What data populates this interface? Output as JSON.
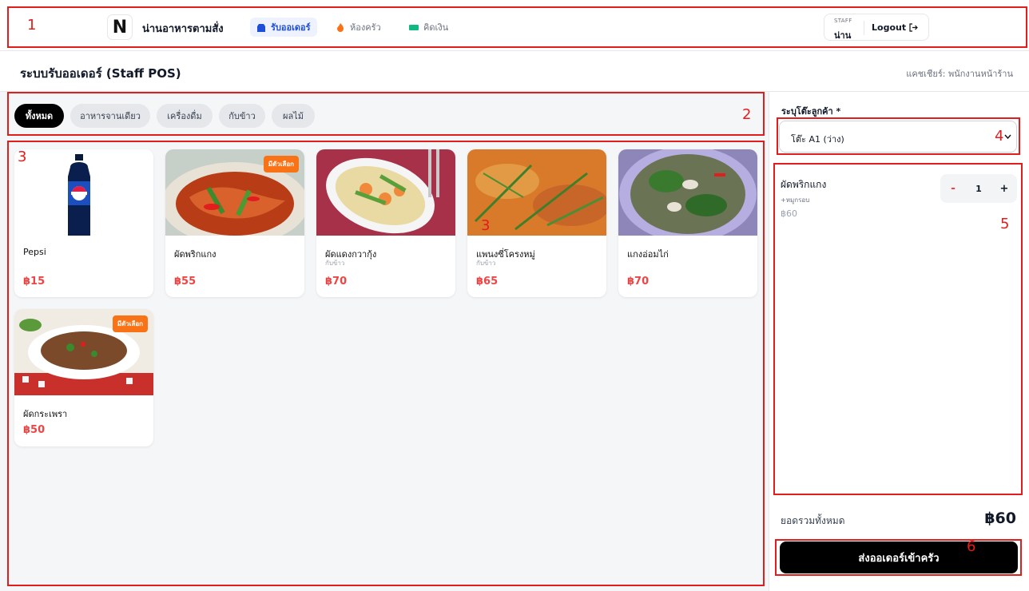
{
  "header": {
    "brand": "น่านอาหารตามสั่ง",
    "logo_letter": "N",
    "nav": [
      {
        "label": "รับออเดอร์",
        "icon": "store-icon",
        "active": true
      },
      {
        "label": "ห้องครัว",
        "icon": "fire-icon",
        "active": false
      },
      {
        "label": "คิดเงิน",
        "icon": "cash-icon",
        "active": false
      }
    ],
    "staff_label": "STAFF",
    "staff_name": "น่าน",
    "logout_label": "Logout",
    "logout_icon": "logout-icon"
  },
  "page": {
    "title": "ระบบรับออเดอร์ (Staff POS)",
    "cashier": "แคชเชียร์: พนักงานหน้าร้าน"
  },
  "categories": [
    {
      "label": "ทั้งหมด",
      "active": true
    },
    {
      "label": "อาหารจานเดียว",
      "active": false
    },
    {
      "label": "เครื่องดื่ม",
      "active": false
    },
    {
      "label": "กับข้าว",
      "active": false
    },
    {
      "label": "ผลไม้",
      "active": false
    }
  ],
  "products": [
    {
      "name": "Pepsi",
      "sub": "",
      "price": "฿15",
      "badge": ""
    },
    {
      "name": "ผัดพริกแกง",
      "sub": "",
      "price": "฿55",
      "badge": "มีตัวเลือก"
    },
    {
      "name": "ผัดแดงกวากุ้ง",
      "sub": "กับข้าว",
      "price": "฿70",
      "badge": ""
    },
    {
      "name": "แพนงซี่โครงหมู่",
      "sub": "กับข้าว",
      "price": "฿65",
      "badge": ""
    },
    {
      "name": "แกงอ่อมไก่",
      "sub": "",
      "price": "฿70",
      "badge": ""
    },
    {
      "name": "ผัดกระเพรา",
      "sub": "",
      "price": "฿50",
      "badge": "มีตัวเลือก"
    }
  ],
  "order": {
    "table_label": "ระบุโต๊ะลูกค้า *",
    "table_value": "โต๊ะ A1 (ว่าง)",
    "items": [
      {
        "name": "ผัดพริกแกง",
        "option": "+หมูกรอบ",
        "price": "฿60",
        "qty": "1",
        "minus": "-",
        "plus": "+"
      }
    ],
    "total_label": "ยอดรวมทั้งหมด",
    "total_value": "฿60",
    "submit_label": "ส่งออเดอร์เข้าครัว"
  },
  "annotations": [
    "1",
    "2",
    "3",
    "3",
    "4",
    "5",
    "6"
  ],
  "colors": {
    "accent_red": "#ef4444",
    "badge_orange": "#f97316",
    "nav_active_blue": "#1d4ed8",
    "annotation_red": "#e11d1d"
  }
}
